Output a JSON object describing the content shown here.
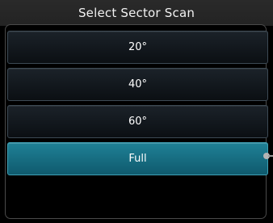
{
  "header": {
    "title": "Select Sector Scan"
  },
  "options": [
    {
      "label": "20°",
      "selected": false
    },
    {
      "label": "40°",
      "selected": false
    },
    {
      "label": "60°",
      "selected": false
    },
    {
      "label": "Full",
      "selected": true
    }
  ],
  "colors": {
    "accent": "#1f8196",
    "background": "#000000",
    "text": "#ffffff"
  }
}
